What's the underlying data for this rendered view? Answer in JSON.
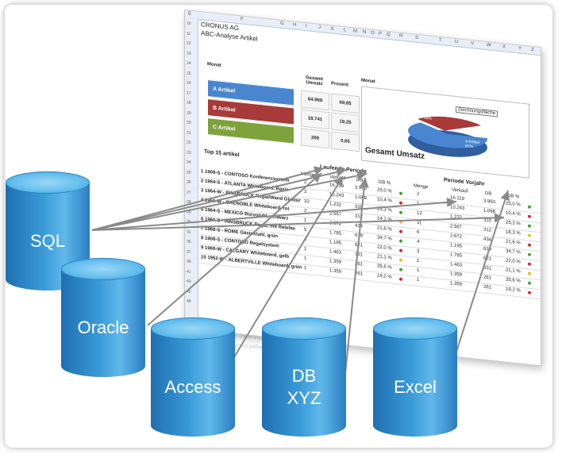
{
  "sheet": {
    "company": "CRONUS AG",
    "title": "ABC-Analyse  Artikel",
    "col_letters": [
      "E",
      "F",
      "G",
      "H",
      "I",
      "J",
      "K",
      "L",
      "M",
      "N",
      "O",
      "P",
      "Q",
      "R",
      "S",
      "T",
      "U",
      "V",
      "W",
      "X",
      "Y",
      "Z"
    ],
    "row_numbers": [
      "10",
      "11",
      "12",
      "13",
      "14",
      "15",
      "16",
      "17",
      "18",
      "19",
      "20",
      "21",
      "22",
      "23",
      "24",
      "25",
      "26",
      "27",
      "28",
      "29",
      "30",
      "31",
      "35",
      "37",
      "39",
      "41",
      "43",
      "45",
      "46"
    ],
    "monat_label": "Monat",
    "monat_label_right": "Monat",
    "col_gesamt": "Gesamt Umsatz",
    "col_prozent": "Prozent",
    "abc": [
      {
        "label": "A Artikel",
        "umsatz": "64.969",
        "prozent": "69,65",
        "color": "#4a86cf"
      },
      {
        "label": "B Artikel",
        "umsatz": "18.741",
        "prozent": "19,25",
        "color": "#a83a3a"
      },
      {
        "label": "C Artikel",
        "umsatz": "269",
        "prozent": "0,65",
        "color": "#7ea33c"
      }
    ],
    "pie": {
      "title": "Gesamt Umsatz",
      "tooltip": "Zeichnungsfläche",
      "label_a": "A Artikel 81%",
      "label_b": "B Artikel 18%"
    },
    "top15_title": "Top 15 artikel",
    "laufende": "Laufende Periode",
    "periode_vorjahr": "Periode Vorjahr",
    "menge": "Menge",
    "verkauf": "Verkauf",
    "db": "DB",
    "db_pct": "DB %",
    "items": [
      "1 1908-S - CONTOSO Konferenzsystem",
      "2 1964-S - ATLANTA Whiteboard, Basis",
      "3 1964-W - INNSBRUCK Regal/Wand Glastür",
      "4 1956-W - GRENOBLE Whiteboard, rot",
      "5 1964-S - MEXICO Bürostuhl, schwarz",
      "6 1960-S - INNSBRUCK Regal, mit Relefax",
      "7 1968-S - ROME Gästestuhl, grün",
      "8 1908-S - CONTOSO Regalsystem",
      "9 1968-W - CALGARY Whiteboard, gelb",
      "10 1952-W - ALBERTVILLE Whiteboard, grün"
    ],
    "laufend_menge": [
      "2",
      "3",
      "10",
      "2",
      "1",
      "5",
      "4",
      "1",
      "1",
      "1"
    ],
    "laufend_verkauf": [
      "16.119",
      "10.243",
      "1.232",
      "2.567",
      "2.672",
      "1.785",
      "1.195",
      "1.463",
      "1.359",
      "1.359"
    ],
    "laufend_db": [
      "3.963",
      "1.068",
      "310",
      "312",
      "434",
      "619",
      "621",
      "331",
      "261",
      "261"
    ],
    "laufend_dbpct": [
      "25,0 %",
      "10,4 %",
      "25,3 %",
      "14,1 %",
      "21,6 %",
      "34,7 %",
      "22,0 %",
      "21,1 %",
      "35,6 %",
      "19,2 %"
    ],
    "vorjahr_menge": [
      "2",
      "1",
      "12",
      "11",
      "6",
      "4",
      "3",
      "1",
      "1",
      "1"
    ],
    "vorjahr_verkauf": [
      "16.119",
      "10.243",
      "1.232",
      "2.567",
      "2.672",
      "1.195",
      "1.785",
      "1.463",
      "1.359",
      "1.359"
    ],
    "vorjahr_db": [
      "3.963",
      "1.068",
      "310",
      "312",
      "434",
      "619",
      "621",
      "331",
      "261",
      "261"
    ],
    "vorjahr_dbpct": [
      "25,0 %",
      "10,4 %",
      "25,3 %",
      "18,3 %",
      "21,6 %",
      "34,7 %",
      "22,0 %",
      "21,1 %",
      "35,6 %",
      "19,2 %"
    ]
  },
  "databases": [
    {
      "name": "SQL",
      "lines": [
        "SQL"
      ]
    },
    {
      "name": "Oracle",
      "lines": [
        "Oracle"
      ]
    },
    {
      "name": "Access",
      "lines": [
        "Access"
      ]
    },
    {
      "name": "DB XYZ",
      "lines": [
        "DB",
        "XYZ"
      ]
    },
    {
      "name": "Excel",
      "lines": [
        "Excel"
      ]
    }
  ],
  "colors": {
    "cylinder": "#2f8fd0",
    "arrow": "#8a8a8a",
    "status_green": "#3aa43a",
    "status_red": "#cc2b2b",
    "status_yellow": "#e0c020"
  }
}
